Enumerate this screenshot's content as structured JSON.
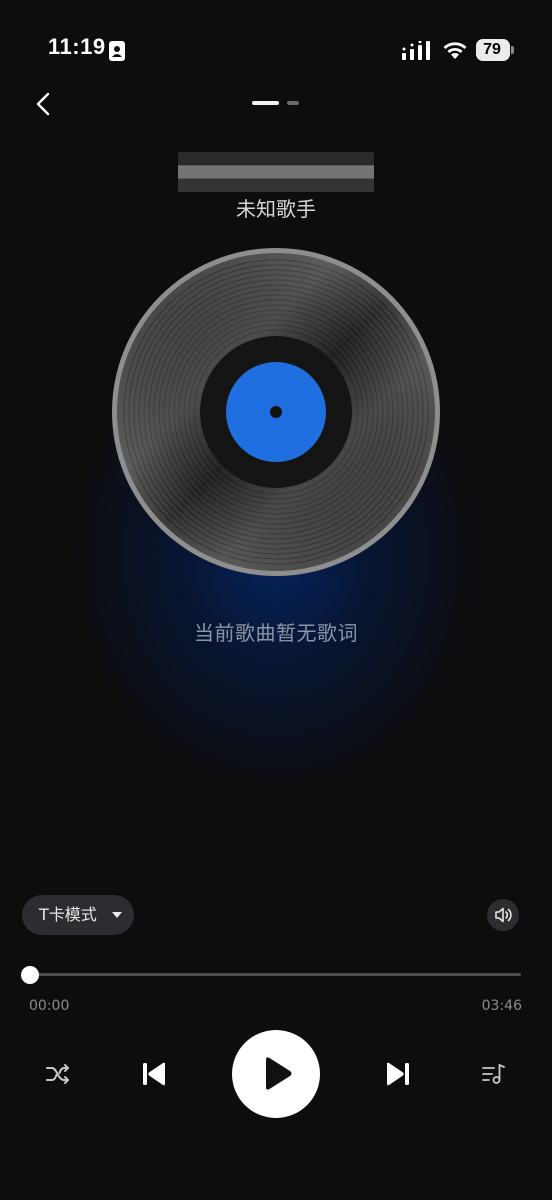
{
  "status_bar": {
    "time": "11:19",
    "battery": "79",
    "icons": [
      "contact-card-icon",
      "cellular-signal-icon",
      "wifi-icon",
      "battery-icon"
    ]
  },
  "header": {
    "back_icon": "chevron-left-icon",
    "pager_count": 2,
    "pager_active_index": 0
  },
  "song": {
    "title_obscured": true,
    "artist": "未知歌手"
  },
  "lyrics": {
    "empty_text": "当前歌曲暂无歌词"
  },
  "controls": {
    "mode_label": "T卡模式",
    "mode_icon": "caret-down-icon",
    "volume_icon": "speaker-icon",
    "progress": {
      "current": "00:00",
      "total": "03:46",
      "fraction": 0.0
    },
    "buttons": [
      "shuffle-icon",
      "skip-previous-icon",
      "play-icon",
      "skip-next-icon",
      "playlist-icon"
    ]
  },
  "colors": {
    "background": "#0d0d0e",
    "accent_blue": "#1f6fe0",
    "glow_blue": "#04286e",
    "pill_bg": "#2c2d30",
    "lyric_text": "#8b95a5"
  }
}
